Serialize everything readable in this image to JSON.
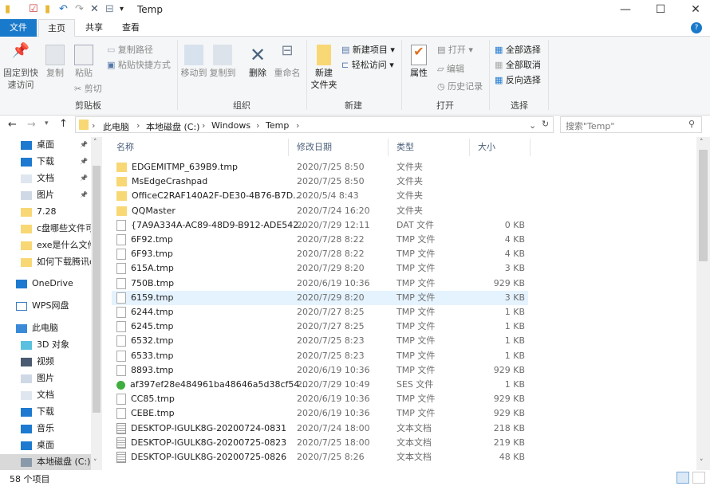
{
  "window": {
    "title": "Temp",
    "minimize": "—",
    "maximize": "☐",
    "close": "✕"
  },
  "tabs": [
    {
      "label": "文件"
    },
    {
      "label": "主页"
    },
    {
      "label": "共享"
    },
    {
      "label": "查看"
    }
  ],
  "ribbon": {
    "clipboard": {
      "group": "剪贴板",
      "pin": "固定到快\n速访问",
      "copy": "复制",
      "paste": "粘贴",
      "copy_path": "复制路径",
      "paste_shortcut": "粘贴快捷方式",
      "cut": "剪切"
    },
    "organize": {
      "group": "组织",
      "move_to": "移动到",
      "copy_to": "复制到",
      "delete": "删除",
      "rename": "重命名"
    },
    "new": {
      "group": "新建",
      "new_folder": "新建\n文件夹",
      "new_item": "新建项目 ▾",
      "easy_access": "轻松访问 ▾"
    },
    "open": {
      "group": "打开",
      "properties": "属性",
      "open": "打开 ▾",
      "edit": "编辑",
      "history": "历史记录"
    },
    "select": {
      "group": "选择",
      "select_all": "全部选择",
      "select_none": "全部取消",
      "invert": "反向选择"
    }
  },
  "address": {
    "crumbs": [
      "此电脑",
      "本地磁盘 (C:)",
      "Windows",
      "Temp"
    ],
    "search_placeholder": "搜索\"Temp\""
  },
  "nav": [
    {
      "label": "桌面",
      "icon": "desktop",
      "pin": true
    },
    {
      "label": "下载",
      "icon": "download",
      "pin": true
    },
    {
      "label": "文档",
      "icon": "document",
      "pin": true
    },
    {
      "label": "图片",
      "icon": "pictures",
      "pin": true
    },
    {
      "label": "7.28",
      "icon": "folder"
    },
    {
      "label": "c盘哪些文件可",
      "icon": "folder"
    },
    {
      "label": "exe是什么文件",
      "icon": "folder"
    },
    {
      "label": "如何下载腾讯c",
      "icon": "folder"
    },
    {
      "label": "OneDrive",
      "icon": "onedrive"
    },
    {
      "label": "WPS网盘",
      "icon": "cloud"
    },
    {
      "label": "此电脑",
      "icon": "computer"
    },
    {
      "label": "3D 对象",
      "icon": "3d"
    },
    {
      "label": "视频",
      "icon": "video"
    },
    {
      "label": "图片",
      "icon": "pictures"
    },
    {
      "label": "文档",
      "icon": "document"
    },
    {
      "label": "下载",
      "icon": "download"
    },
    {
      "label": "音乐",
      "icon": "music"
    },
    {
      "label": "桌面",
      "icon": "desktop"
    },
    {
      "label": "本地磁盘 (C:)",
      "icon": "drive",
      "selected": true
    }
  ],
  "columns": {
    "name": "名称",
    "date": "修改日期",
    "type": "类型",
    "size": "大小"
  },
  "files": [
    {
      "name": "EDGEMITMP_639B9.tmp",
      "date": "2020/7/25 8:50",
      "type": "文件夹",
      "size": "",
      "icon": "folder"
    },
    {
      "name": "MsEdgeCrashpad",
      "date": "2020/7/25 8:50",
      "type": "文件夹",
      "size": "",
      "icon": "folder"
    },
    {
      "name": "OfficeC2RAF140A2F-DE30-4B76-B7D...",
      "date": "2020/5/4 8:43",
      "type": "文件夹",
      "size": "",
      "icon": "folder"
    },
    {
      "name": "QQMaster",
      "date": "2020/7/24 16:20",
      "type": "文件夹",
      "size": "",
      "icon": "folder"
    },
    {
      "name": "{7A9A334A-AC89-48D9-B912-ADE542...",
      "date": "2020/7/29 12:11",
      "type": "DAT 文件",
      "size": "0 KB",
      "icon": "dat"
    },
    {
      "name": "6F92.tmp",
      "date": "2020/7/28 8:22",
      "type": "TMP 文件",
      "size": "4 KB",
      "icon": "file"
    },
    {
      "name": "6F93.tmp",
      "date": "2020/7/28 8:22",
      "type": "TMP 文件",
      "size": "4 KB",
      "icon": "file"
    },
    {
      "name": "615A.tmp",
      "date": "2020/7/29 8:20",
      "type": "TMP 文件",
      "size": "3 KB",
      "icon": "file"
    },
    {
      "name": "750B.tmp",
      "date": "2020/6/19 10:36",
      "type": "TMP 文件",
      "size": "929 KB",
      "icon": "file"
    },
    {
      "name": "6159.tmp",
      "date": "2020/7/29 8:20",
      "type": "TMP 文件",
      "size": "3 KB",
      "icon": "file",
      "selected": true
    },
    {
      "name": "6244.tmp",
      "date": "2020/7/27 8:25",
      "type": "TMP 文件",
      "size": "1 KB",
      "icon": "file"
    },
    {
      "name": "6245.tmp",
      "date": "2020/7/27 8:25",
      "type": "TMP 文件",
      "size": "1 KB",
      "icon": "file"
    },
    {
      "name": "6532.tmp",
      "date": "2020/7/25 8:23",
      "type": "TMP 文件",
      "size": "1 KB",
      "icon": "file"
    },
    {
      "name": "6533.tmp",
      "date": "2020/7/25 8:23",
      "type": "TMP 文件",
      "size": "1 KB",
      "icon": "file"
    },
    {
      "name": "8893.tmp",
      "date": "2020/6/19 10:36",
      "type": "TMP 文件",
      "size": "929 KB",
      "icon": "file"
    },
    {
      "name": "af397ef28e484961ba48646a5d38cf54...",
      "date": "2020/7/29 10:49",
      "type": "SES 文件",
      "size": "1 KB",
      "icon": "ses"
    },
    {
      "name": "CC85.tmp",
      "date": "2020/6/19 10:36",
      "type": "TMP 文件",
      "size": "929 KB",
      "icon": "file"
    },
    {
      "name": "CEBE.tmp",
      "date": "2020/6/19 10:36",
      "type": "TMP 文件",
      "size": "929 KB",
      "icon": "file"
    },
    {
      "name": "DESKTOP-IGULK8G-20200724-0831",
      "date": "2020/7/24 18:00",
      "type": "文本文档",
      "size": "218 KB",
      "icon": "text"
    },
    {
      "name": "DESKTOP-IGULK8G-20200725-0823",
      "date": "2020/7/25 18:00",
      "type": "文本文档",
      "size": "219 KB",
      "icon": "text"
    },
    {
      "name": "DESKTOP-IGULK8G-20200725-0826",
      "date": "2020/7/25 8:26",
      "type": "文本文档",
      "size": "48 KB",
      "icon": "text"
    }
  ],
  "status": {
    "count": "58 个项目"
  },
  "colors": {
    "accent": "#1979ca",
    "folder": "#f8d775",
    "selection": "#e5f3ff",
    "nav_selected": "#d9d9d9"
  }
}
